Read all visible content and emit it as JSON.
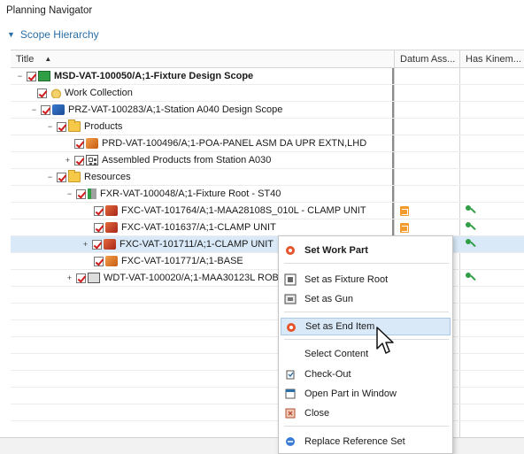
{
  "panel": {
    "title": "Planning Navigator",
    "scope_label": "Scope Hierarchy"
  },
  "columns": {
    "title": "Title",
    "datum": "Datum Ass...",
    "kinematics": "Has Kinem..."
  },
  "rows": [
    {
      "label": "MSD-VAT-100050/A;1-Fixture Design Scope"
    },
    {
      "label": "Work Collection"
    },
    {
      "label": "PRZ-VAT-100283/A;1-Station A040 Design Scope"
    },
    {
      "label": "Products"
    },
    {
      "label": "PRD-VAT-100496/A;1-POA-PANEL ASM DA UPR EXTN,LHD"
    },
    {
      "label": "Assembled Products from Station A030"
    },
    {
      "label": "Resources"
    },
    {
      "label": "FXR-VAT-100048/A;1-Fixture Root - ST40"
    },
    {
      "label": "FXC-VAT-101764/A;1-MAA28108S_010L - CLAMP UNIT"
    },
    {
      "label": "FXC-VAT-101637/A;1-CLAMP UNIT"
    },
    {
      "label": "FXC-VAT-101711/A;1-CLAMP UNIT"
    },
    {
      "label": "FXC-VAT-101771/A;1-BASE"
    },
    {
      "label": "WDT-VAT-100020/A;1-MAA30123L ROBO"
    }
  ],
  "context_menu": {
    "items": [
      {
        "label": "Set Work Part"
      },
      {
        "label": "Set as Fixture Root"
      },
      {
        "label": "Set as Gun"
      },
      {
        "label": "Set as End Item"
      },
      {
        "label": "Select Content"
      },
      {
        "label": "Check-Out"
      },
      {
        "label": "Open Part in Window"
      },
      {
        "label": "Close"
      },
      {
        "label": "Replace Reference Set"
      }
    ]
  },
  "colors": {
    "accent": "#2a6fa8",
    "highlight": "#d9e9f7",
    "check": "#d11b1b",
    "datum_badge": "#f29a2e",
    "kin_badge": "#2f9e44"
  },
  "icons": {
    "expand_collapsed": "plus-icon",
    "expand_open": "minus-icon",
    "scope": "scope-icon",
    "folder": "folder-icon",
    "part": "part-icon",
    "clamp": "clamp-icon",
    "assembly": "assembly-icon",
    "gun": "weld-gun-icon"
  }
}
